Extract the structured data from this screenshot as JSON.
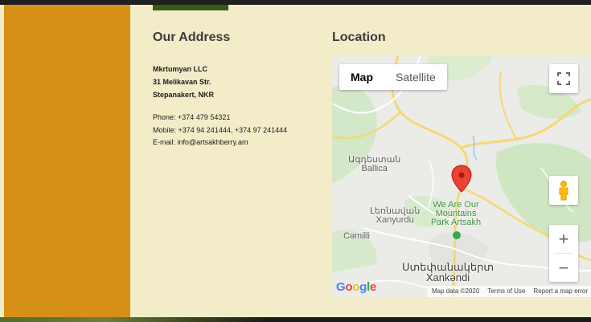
{
  "address": {
    "title": "Our Address",
    "company": "Mkrtumyan LLC",
    "street": "31 Melikavan Str.",
    "city": "Stepanakert, NKR",
    "phone": "Phone: +374 479 54321",
    "mobile": "Mobile: +374 94 241444, +374 97 241444",
    "email": "E-mail: info@artsakhberry.am"
  },
  "location": {
    "title": "Location",
    "map": {
      "map_type_options": [
        "Map",
        "Satellite"
      ],
      "selected_map_type": "Map",
      "labels": {
        "ballica_arm": "Ագդեստան",
        "ballica": "Ballica",
        "xanyurdu_arm": "Լեռնավան",
        "xanyurdu": "Xanyurdu",
        "poi": "We Are Our Mountains Park Artsakh",
        "camilli": "Cəmilli",
        "stepanakert_arm": "Ստեփանակերտ",
        "xankendi": "Xankəndi"
      },
      "zoom_in": "+",
      "zoom_out": "−",
      "brand": "Google",
      "footer": {
        "map_data": "Map data ©2020",
        "terms": "Terms of Use",
        "report": "Report a map error"
      }
    }
  },
  "colors": {
    "sidebar": "#d79017",
    "page_bg": "#f2ecc9",
    "accent_button": "#3a5a14",
    "marker": "#ea4335"
  }
}
